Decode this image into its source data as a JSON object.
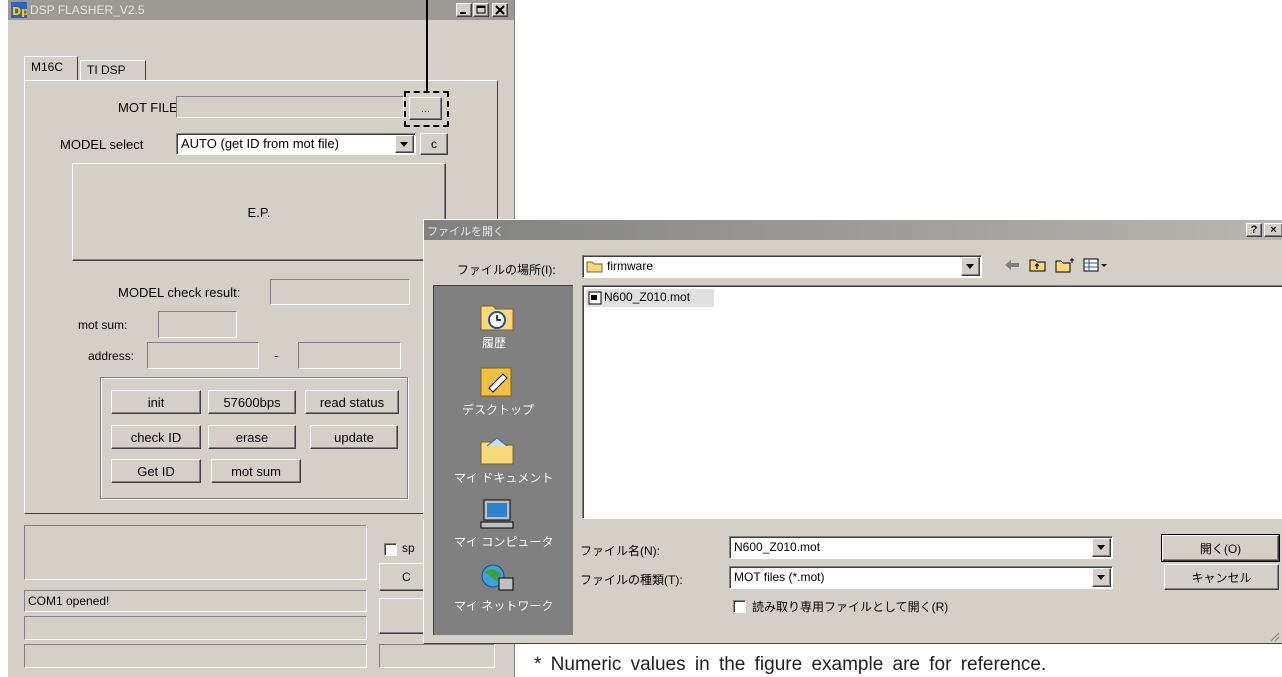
{
  "flasher": {
    "title": "DSP FLASHER_V2.5",
    "tabs": [
      "M16C",
      "TI DSP"
    ],
    "mot_file_label": "MOT FILE",
    "mot_file_value": "",
    "browse_label": "...",
    "model_select_label": "MODEL select",
    "model_select_value": "AUTO (get ID from mot file)",
    "c_button": "c",
    "ep_label": "E.P.",
    "model_check_label": "MODEL check result:",
    "mot_sum_label": "mot sum:",
    "address_label": "address:",
    "address_dash": "-",
    "buttons": {
      "init": "init",
      "baud": "57600bps",
      "read_status": "read status",
      "check_id": "check ID",
      "erase": "erase",
      "update": "update",
      "get_id": "Get ID",
      "mot_sum": "mot sum"
    },
    "sp_checkbox": "sp",
    "c_partial": "C",
    "status_line": "COM1 opened!"
  },
  "dialog": {
    "title": "ファイルを開く",
    "help_btn": "?",
    "close_btn": "×",
    "look_in_label": "ファイルの場所(I):",
    "look_in_value": "firmware",
    "places": [
      "履歴",
      "デスクトップ",
      "マイ ドキュメント",
      "マイ コンピュータ",
      "マイ ネットワーク"
    ],
    "files": [
      "N600_Z010.mot"
    ],
    "filename_label": "ファイル名(N):",
    "filename_value": "N600_Z010.mot",
    "filetype_label": "ファイルの種類(T):",
    "filetype_value": "MOT files (*.mot)",
    "readonly_label": "読み取り専用ファイルとして開く(R)",
    "open_btn": "開く(O)",
    "cancel_btn": "キャンセル"
  },
  "note": "* Numeric values in the figure example are for reference."
}
